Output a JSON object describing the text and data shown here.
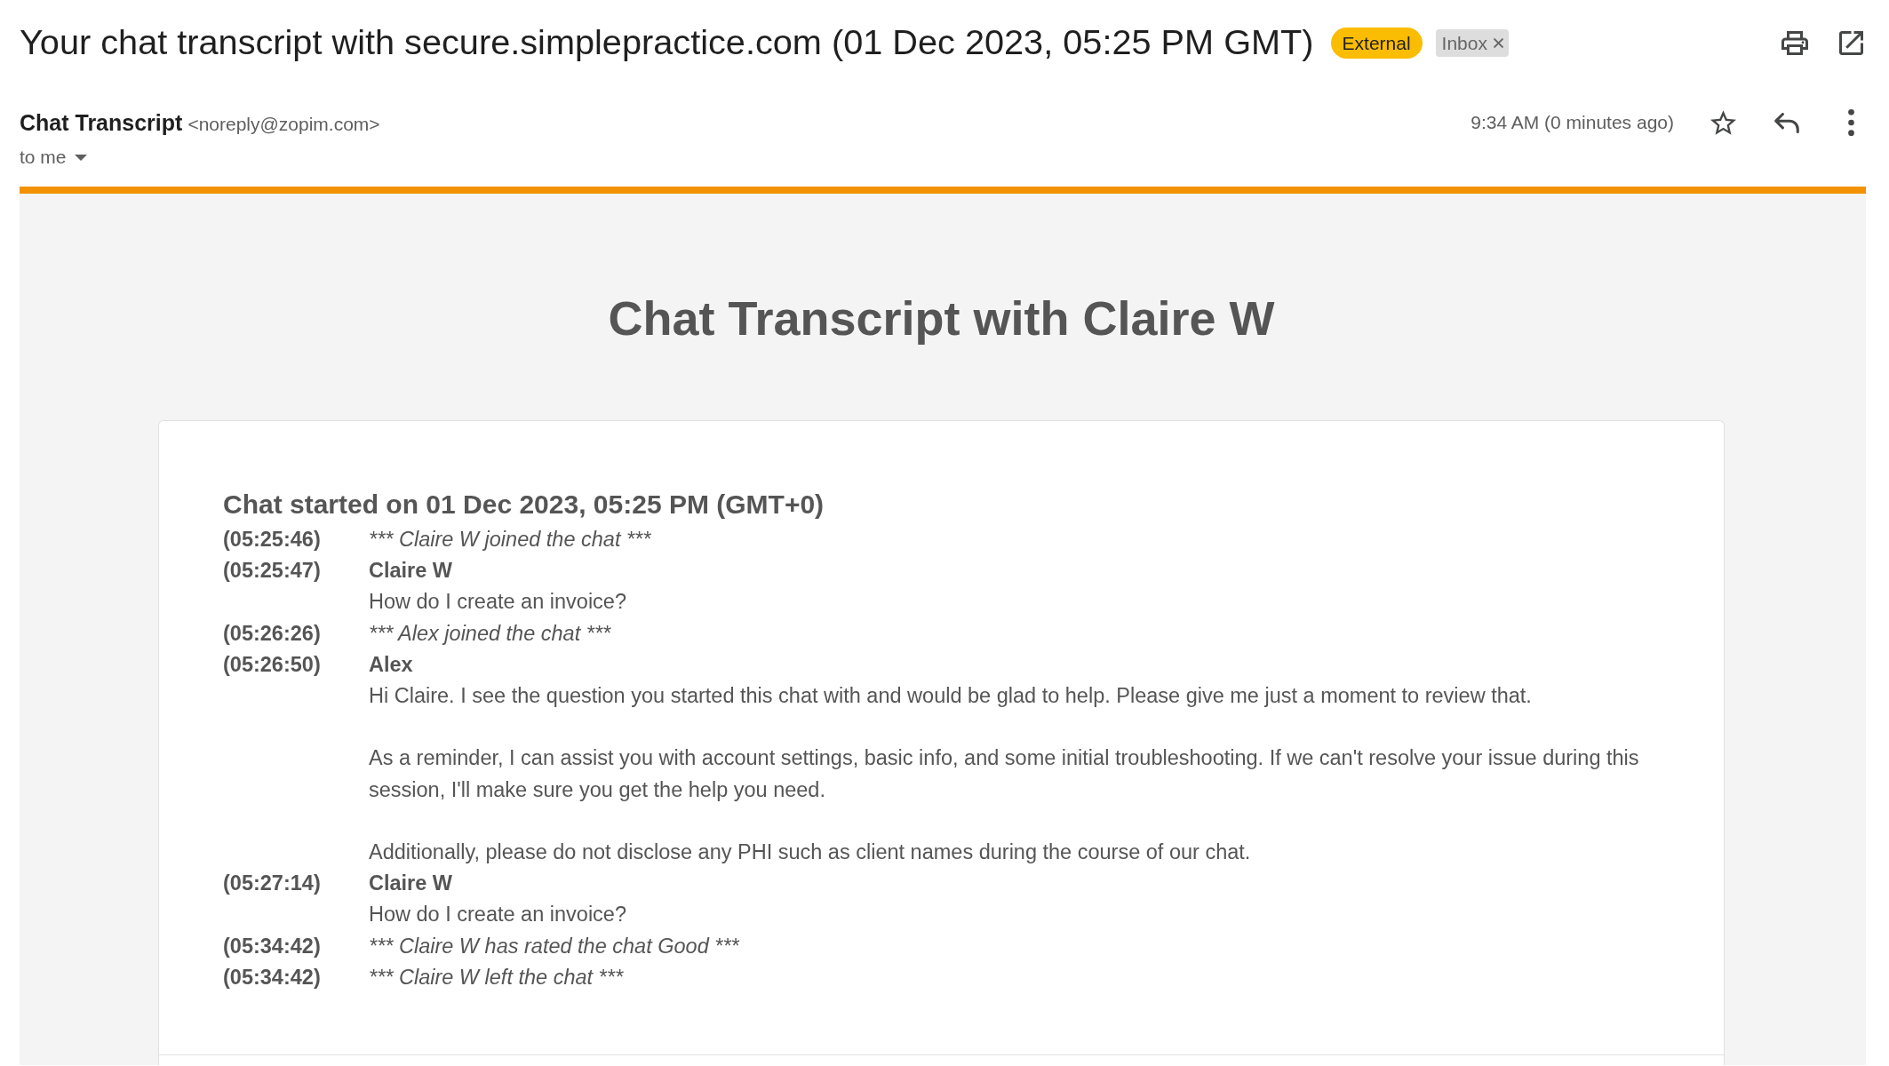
{
  "email": {
    "subject": "Your chat transcript with secure.simplepractice.com (01 Dec 2023, 05:25 PM GMT)",
    "labels": [
      {
        "text": "External",
        "kind": "external"
      },
      {
        "text": "Inbox",
        "kind": "folder"
      }
    ],
    "sender": {
      "name": "Chat Transcript",
      "address": "<noreply@zopim.com>"
    },
    "recipient": "to me",
    "time": "9:34 AM (0 minutes ago)",
    "starred": false
  },
  "transcript": {
    "title": "Chat Transcript with Claire W",
    "started": "Chat started on 01 Dec 2023, 05:25 PM (GMT+0)",
    "entries": [
      {
        "time": "(05:25:46)",
        "kind": "event",
        "text": "*** Claire W joined the chat ***"
      },
      {
        "time": "(05:25:47)",
        "kind": "message",
        "author": "Claire W",
        "paragraphs": [
          "How do I create an invoice?"
        ]
      },
      {
        "time": "(05:26:26)",
        "kind": "event",
        "text": "*** Alex joined the chat ***"
      },
      {
        "time": "(05:26:50)",
        "kind": "message",
        "author": "Alex",
        "paragraphs": [
          "Hi Claire. I see the question you started this chat with and would be glad to help. Please give me just a moment to review that.",
          "As a reminder, I can assist you with account settings, basic info, and some initial troubleshooting. If we can't resolve your issue during this session, I'll make sure you get the help you need.",
          "Additionally, please do not disclose any PHI such as client names during the course of our chat."
        ]
      },
      {
        "time": "(05:27:14)",
        "kind": "message",
        "author": "Claire W",
        "paragraphs": [
          "How do I create an invoice?"
        ]
      },
      {
        "time": "(05:34:42)",
        "kind": "event",
        "text": "*** Claire W has rated the chat Good ***"
      },
      {
        "time": "(05:34:42)",
        "kind": "event",
        "text": "*** Claire W left the chat ***"
      }
    ]
  }
}
